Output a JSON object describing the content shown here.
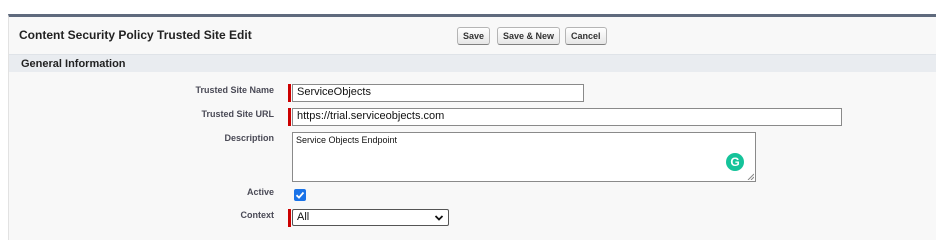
{
  "header": {
    "title": "Content Security Policy Trusted Site Edit",
    "save_label": "Save",
    "save_new_label": "Save & New",
    "cancel_label": "Cancel"
  },
  "section": {
    "title": "General Information"
  },
  "form": {
    "trusted_site_name": {
      "label": "Trusted Site Name",
      "value": "ServiceObjects"
    },
    "trusted_site_url": {
      "label": "Trusted Site URL",
      "value": "https://trial.serviceobjects.com"
    },
    "description": {
      "label": "Description",
      "value": "Service Objects Endpoint"
    },
    "active": {
      "label": "Active",
      "checked": true
    },
    "context": {
      "label": "Context",
      "value": "All"
    }
  },
  "icons": {
    "grammarly": "grammarly-icon",
    "checkmark": "checkmark-icon",
    "chevron": "chevron-down-icon"
  },
  "colors": {
    "required_bar": "#cc0000",
    "header_border": "#5f6a7d",
    "section_bg": "#e9ecf0",
    "checkbox": "#1a73e8",
    "grammarly": "#15c39a"
  }
}
